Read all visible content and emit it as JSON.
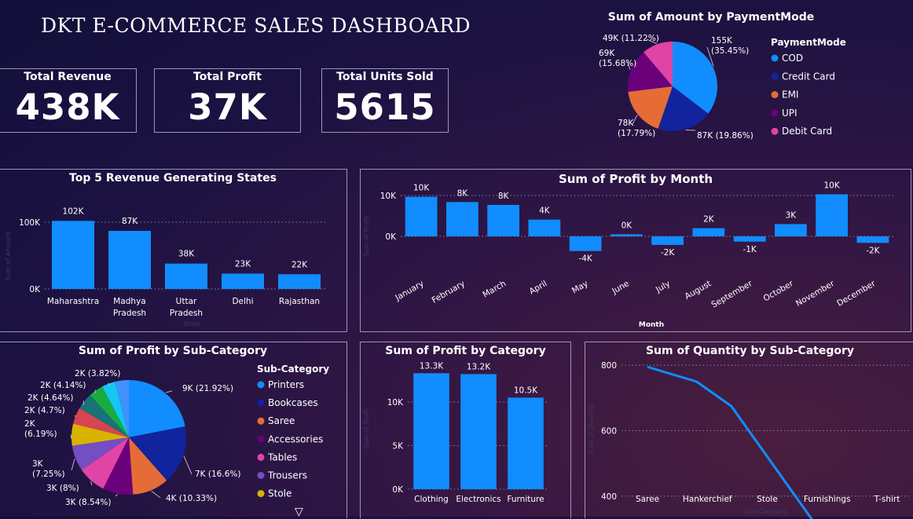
{
  "dashboard": {
    "title": "DKT E-COMMERCE SALES DASHBOARD",
    "kpis": [
      {
        "label": "Total Revenue",
        "value": "438K"
      },
      {
        "label": "Total Profit",
        "value": "37K"
      },
      {
        "label": "Total Units Sold",
        "value": "5615"
      }
    ],
    "scroll_glyph": "▽"
  },
  "chart_data": [
    {
      "id": "payment",
      "type": "pie",
      "title": "Sum of Amount by PaymentMode",
      "legend_title": "PaymentMode",
      "legend_position": "right",
      "slices": [
        {
          "name": "COD",
          "value": 155,
          "label": "155K (35.45%)",
          "color": "#118DFF"
        },
        {
          "name": "Credit Card",
          "value": 87,
          "label": "87K (19.86%)",
          "color": "#12239E"
        },
        {
          "name": "EMI",
          "value": 78,
          "label": "78K (17.79%)",
          "color": "#E66C37"
        },
        {
          "name": "UPI",
          "value": 69,
          "label": "69K (15.68%)",
          "color": "#6B007B"
        },
        {
          "name": "Debit Card",
          "value": 49,
          "label": "49K (11.22%)",
          "color": "#E044A7"
        }
      ]
    },
    {
      "id": "states",
      "type": "bar",
      "title": "Top 5 Revenue Generating States",
      "xlabel": "State",
      "ylabel": "Sum of Amount",
      "categories": [
        "Maharashtra",
        "Madhya Pradesh",
        "Uttar Pradesh",
        "Delhi",
        "Rajasthan"
      ],
      "values": [
        102,
        87,
        38,
        23,
        22
      ],
      "data_labels": [
        "102K",
        "87K",
        "38K",
        "23K",
        "22K"
      ],
      "ylim": [
        0,
        120
      ],
      "yticks": [
        {
          "v": 0,
          "t": "0K"
        },
        {
          "v": 100,
          "t": "100K"
        }
      ],
      "grid": true
    },
    {
      "id": "month",
      "type": "bar",
      "title": "Sum of Profit by Month",
      "xlabel": "Month",
      "ylabel": "Sum of Profit",
      "categories": [
        "January",
        "February",
        "March",
        "April",
        "May",
        "June",
        "July",
        "August",
        "September",
        "October",
        "November",
        "December"
      ],
      "values": [
        9.7,
        8.4,
        7.7,
        4.1,
        -3.6,
        0.5,
        -2.1,
        2.0,
        -1.3,
        3.0,
        10.3,
        -1.6
      ],
      "data_labels": [
        "10K",
        "8K",
        "8K",
        "4K",
        "-4K",
        "0K",
        "-2K",
        "2K",
        "-1K",
        "3K",
        "10K",
        "-2K"
      ],
      "ylim": [
        -5,
        12
      ],
      "yticks": [
        {
          "v": 0,
          "t": "0K"
        },
        {
          "v": 10,
          "t": "10K"
        }
      ],
      "grid": true
    },
    {
      "id": "subcat",
      "type": "pie",
      "title": "Sum of Profit by Sub-Category",
      "legend_title": "Sub-Category",
      "legend_position": "right",
      "slices": [
        {
          "name": "Printers",
          "value": 21.92,
          "label": "9K (21.92%)",
          "color": "#118DFF"
        },
        {
          "name": "Bookcases",
          "value": 16.6,
          "label": "7K (16.6%)",
          "color": "#12239E"
        },
        {
          "name": "Saree",
          "value": 10.33,
          "label": "4K (10.33%)",
          "color": "#E66C37"
        },
        {
          "name": "Accessories",
          "value": 8.54,
          "label": "3K (8.54%)",
          "color": "#6B007B"
        },
        {
          "name": "Tables",
          "value": 8.0,
          "label": "3K (8%)",
          "color": "#E044A7"
        },
        {
          "name": "Trousers",
          "value": 7.25,
          "label": "3K (7.25%)",
          "color": "#744EC2"
        },
        {
          "name": "Stole",
          "value": 6.19,
          "label": "2K (6.19%)",
          "color": "#D9B300"
        },
        {
          "name": "",
          "value": 4.7,
          "label": "2K (4.7%)",
          "color": "#D64550"
        },
        {
          "name": "",
          "value": 4.64,
          "label": "2K (4.64%)",
          "color": "#197278"
        },
        {
          "name": "",
          "value": 4.14,
          "label": "2K (4.14%)",
          "color": "#1AAB40"
        },
        {
          "name": "",
          "value": 3.82,
          "label": "2K (3.82%)",
          "color": "#15C6F4"
        },
        {
          "name": "",
          "value": 3.87,
          "label": "",
          "color": "#4092FF"
        }
      ],
      "legend": [
        "Printers",
        "Bookcases",
        "Saree",
        "Accessories",
        "Tables",
        "Trousers",
        "Stole"
      ]
    },
    {
      "id": "category",
      "type": "bar",
      "title": "Sum of Profit by Category",
      "xlabel": "Category",
      "ylabel": "Sum of Profit",
      "categories": [
        "Clothing",
        "Electronics",
        "Furniture"
      ],
      "values": [
        13.3,
        13.2,
        10.5
      ],
      "data_labels": [
        "13.3K",
        "13.2K",
        "10.5K"
      ],
      "ylim": [
        0,
        14.5
      ],
      "yticks": [
        {
          "v": 0,
          "t": "0K"
        },
        {
          "v": 5,
          "t": "5K"
        },
        {
          "v": 10,
          "t": "10K"
        }
      ],
      "grid": true
    },
    {
      "id": "quantity",
      "type": "line",
      "title": "Sum of Quantity by Sub-Category",
      "xlabel": "Sub-Category",
      "ylabel": "Sum of Quantity",
      "categories": [
        "Saree",
        "Hankerchief",
        "Stole",
        "Furnishings",
        "T-shirt"
      ],
      "x_positions": [
        0,
        0.8,
        2,
        2.5,
        3,
        4
      ],
      "values": [
        795,
        750,
        675,
        320,
        318
      ],
      "ylim": [
        330,
        810
      ],
      "yticks": [
        {
          "v": 400,
          "t": "400"
        },
        {
          "v": 600,
          "t": "600"
        },
        {
          "v": 800,
          "t": "800"
        }
      ],
      "grid": true
    }
  ],
  "colors": {
    "bar": "#118DFF",
    "grid": "#8a86a8",
    "border": "#9a96b8"
  }
}
